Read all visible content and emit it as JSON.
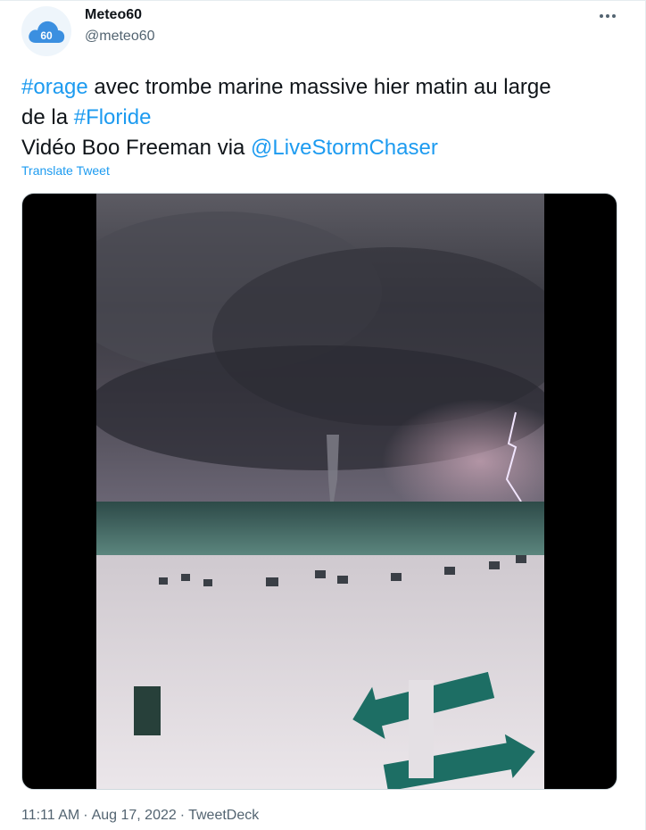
{
  "author": {
    "display_name": "Meteo60",
    "handle": "@meteo60",
    "avatar_text": "60",
    "avatar_icon": "cloud-icon"
  },
  "tweet": {
    "line1": {
      "tag": "#orage",
      "text": " avec trombe marine massive hier matin au large"
    },
    "line2": {
      "text": "de la ",
      "tag": "#Floride"
    },
    "line3": {
      "text": "Vidéo Boo Freeman via ",
      "mention": "@LiveStormChaser"
    },
    "translate_label": "Translate Tweet"
  },
  "media": {
    "type": "video",
    "description_icon": "waterspout-video"
  },
  "footer": {
    "time": "11:11 AM",
    "separator": "·",
    "date": "Aug 17, 2022",
    "source": "TweetDeck"
  },
  "colors": {
    "accent": "#1d9bf0",
    "secondary_text": "#536471"
  }
}
